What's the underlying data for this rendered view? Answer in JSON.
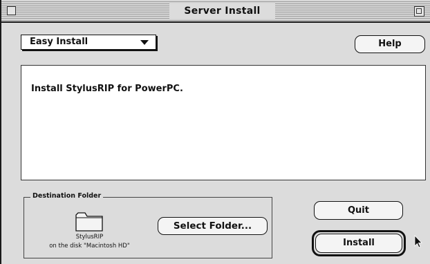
{
  "window": {
    "title": "Server Install"
  },
  "install_type_popup": {
    "selected": "Easy Install",
    "icon": "triangle-down-icon"
  },
  "help_button": {
    "label": "Help"
  },
  "description": {
    "text": "Install StylusRIP for PowerPC."
  },
  "destination": {
    "group_label": "Destination Folder",
    "folder_name": "StylusRIP",
    "disk_line": "on the disk \"Macintosh HD\"",
    "folder_icon": "folder-icon",
    "select_button_label": "Select Folder..."
  },
  "quit_button": {
    "label": "Quit"
  },
  "install_button": {
    "label": "Install"
  },
  "cursor": {
    "icon": "arrow-cursor-icon"
  }
}
